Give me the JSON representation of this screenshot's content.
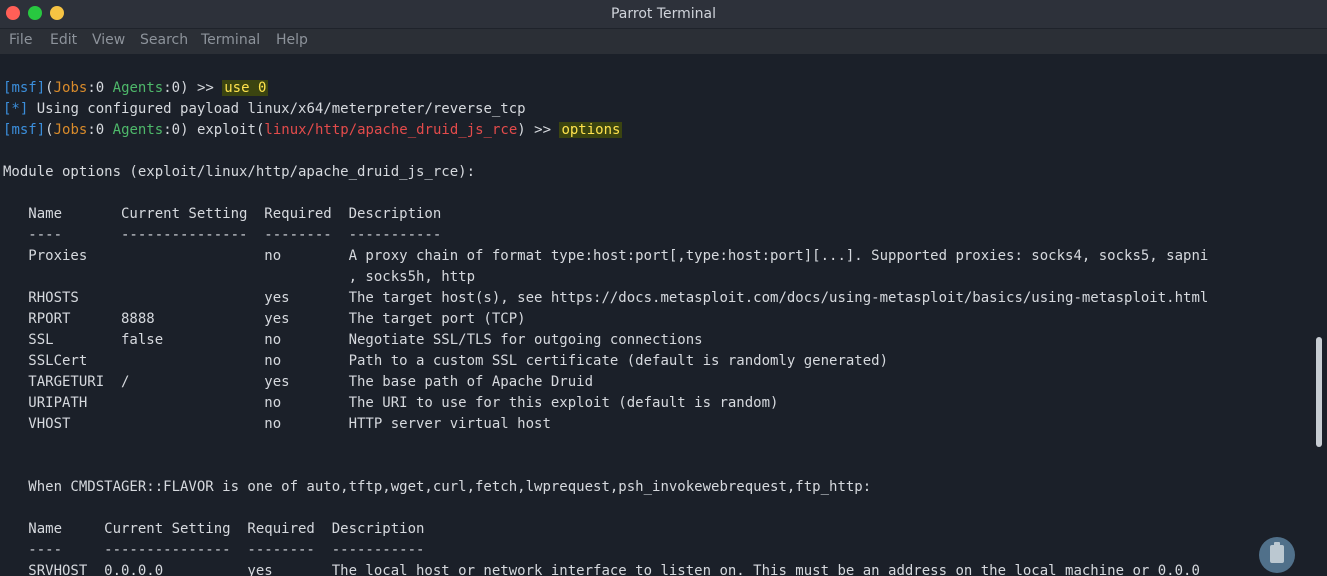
{
  "window": {
    "title": "Parrot Terminal"
  },
  "menubar": {
    "items": [
      "File",
      "Edit",
      "View",
      "Search",
      "Terminal",
      "Help"
    ]
  },
  "prompts": {
    "msf": "msf",
    "jobs_label": "Jobs",
    "jobs_count": "0",
    "agents_label": "Agents",
    "agents_count": "0",
    "arrow": ">>",
    "exploit_label": "exploit",
    "module_path": "linux/http/apache_druid_js_rce",
    "command1": "use 0",
    "command2": "options"
  },
  "output": {
    "info_marker": "[*]",
    "info_text": " Using configured payload linux/x64/meterpreter/reverse_tcp",
    "module_options_heading": "Module options (exploit/linux/http/apache_druid_js_rce):",
    "headers1": "   Name       Current Setting  Required  Description",
    "sep1": "   ----       ---------------  --------  -----------",
    "rows1": [
      "   Proxies                     no        A proxy chain of format type:host:port[,type:host:port][...]. Supported proxies: socks4, socks5, sapni",
      "                                         , socks5h, http",
      "   RHOSTS                      yes       The target host(s), see https://docs.metasploit.com/docs/using-metasploit/basics/using-metasploit.html",
      "   RPORT      8888             yes       The target port (TCP)",
      "   SSL        false            no        Negotiate SSL/TLS for outgoing connections",
      "   SSLCert                     no        Path to a custom SSL certificate (default is randomly generated)",
      "   TARGETURI  /                yes       The base path of Apache Druid",
      "   URIPATH                     no        The URI to use for this exploit (default is random)",
      "   VHOST                       no        HTTP server virtual host"
    ],
    "cmdstager_text": "   When CMDSTAGER::FLAVOR is one of auto,tftp,wget,curl,fetch,lwprequest,psh_invokewebrequest,ftp_http:",
    "headers2": "   Name     Current Setting  Required  Description",
    "sep2": "   ----     ---------------  --------  -----------",
    "partial_row": "   SRVHOST  0.0.0.0          yes       The local host or network interface to listen on. This must be an address on the local machine or 0.0.0"
  }
}
